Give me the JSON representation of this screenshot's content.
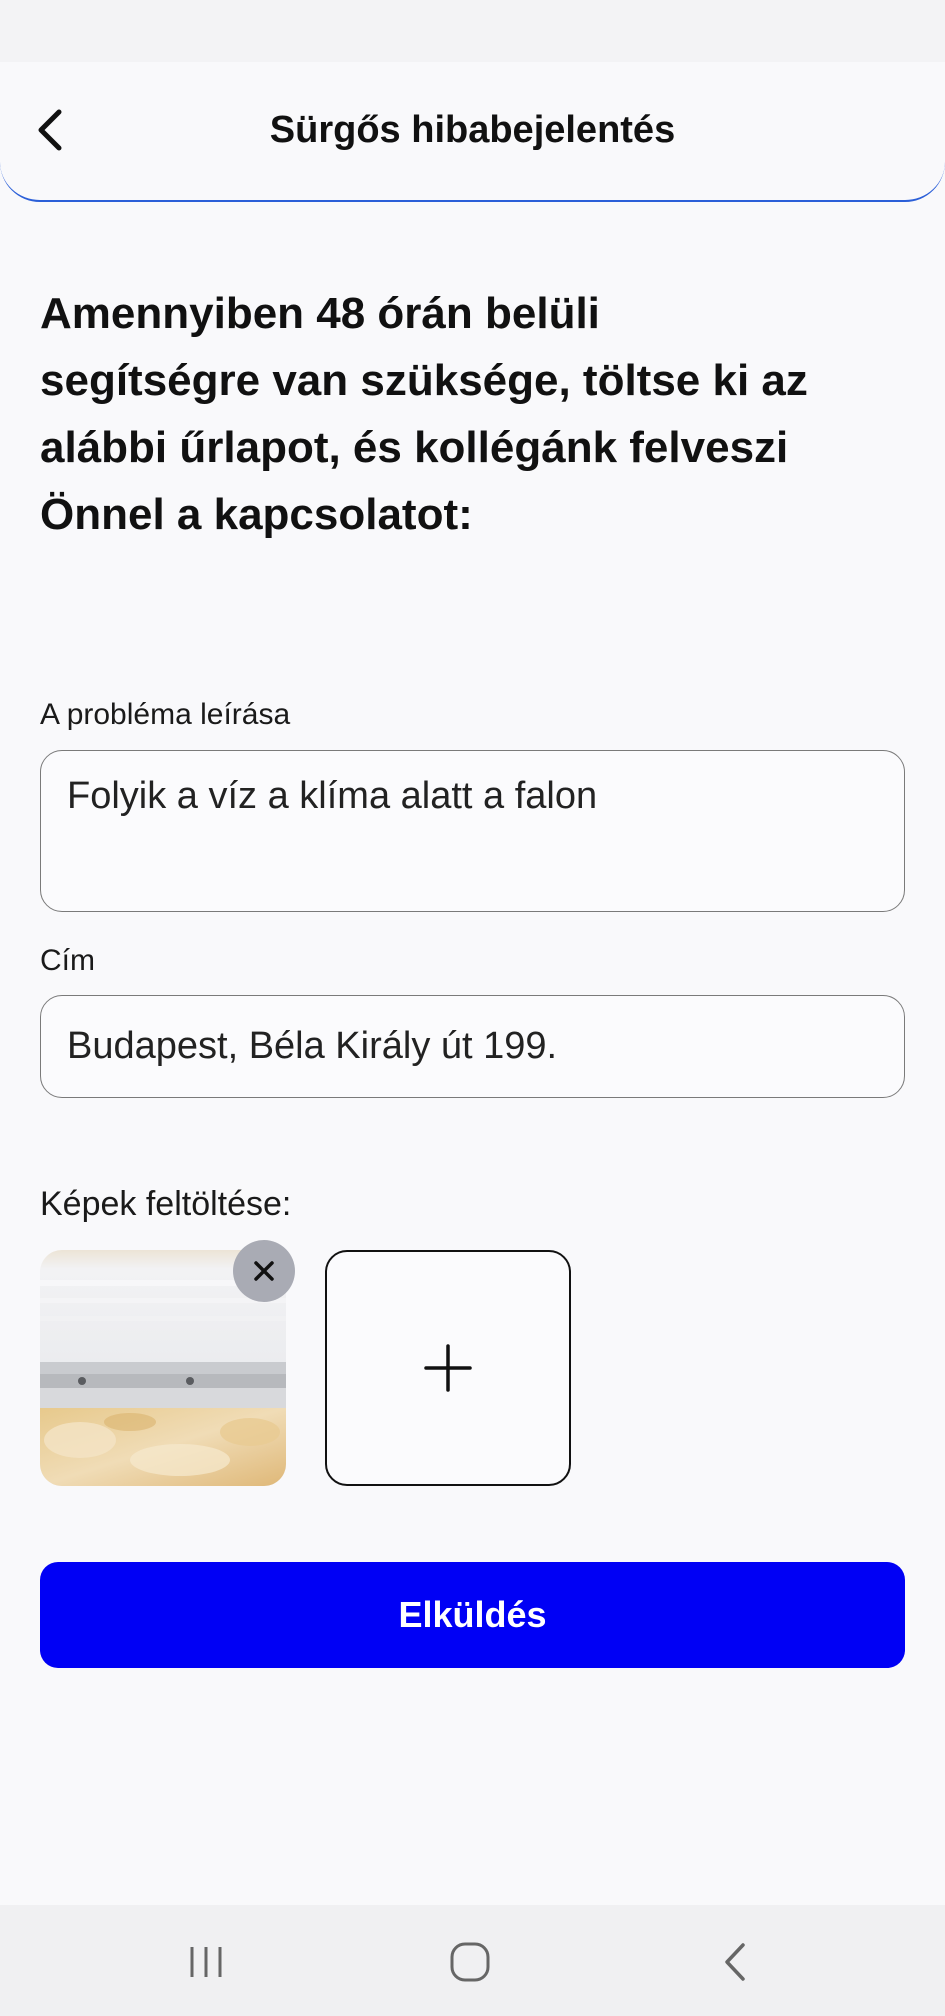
{
  "header": {
    "title": "Sürgős hibabejelentés",
    "back_icon": "chevron-left-icon",
    "accent_color": "#2b5fd8"
  },
  "intro": {
    "text": "Amennyiben 48 órán belüli segítségre van szüksége, töltse ki az alábbi űrlapot, és kollégánk felveszi Önnel a kapcsolatot:"
  },
  "form": {
    "description": {
      "label": "A probléma leírása",
      "value": "Folyik a víz a klíma alatt a falon"
    },
    "address": {
      "label": "Cím",
      "value": "Budapest, Béla Király út 199."
    },
    "images": {
      "label": "Képek feltöltése:",
      "uploaded_count": 1,
      "remove_icon": "close-icon",
      "add_icon": "plus-icon"
    },
    "submit_label": "Elküldés",
    "submit_color": "#0000f5"
  },
  "system_nav": {
    "recents_icon": "recents-icon",
    "home_icon": "home-icon",
    "back_icon": "back-icon"
  }
}
